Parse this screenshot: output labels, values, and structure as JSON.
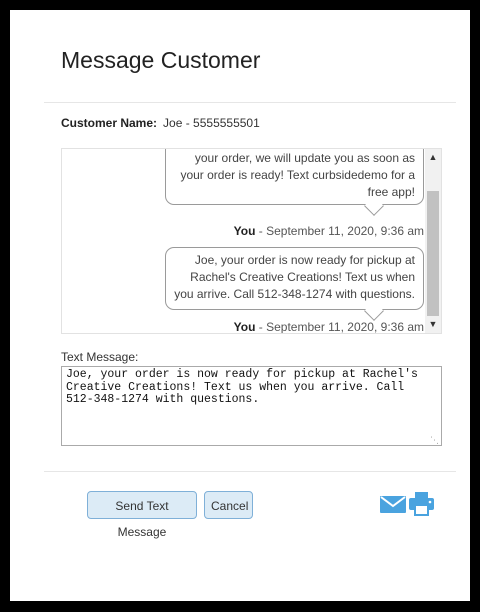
{
  "dialog": {
    "title": "Message Customer"
  },
  "customer": {
    "label": "Customer Name:",
    "value": "Joe - 5555555501"
  },
  "thread": {
    "messages": [
      {
        "text": "your order, we will update you as soon as your order is ready! Text curbsidedemo for a free app!",
        "sender": "You",
        "timestamp": " - September 11, 2020, 9:36 am"
      },
      {
        "text": "Joe, your order is now ready for pickup at Rachel's Creative Creations! Text us when you arrive. Call 512-348-1274 with questions.",
        "sender": "You",
        "timestamp": " - September 11, 2020, 9:36 am"
      }
    ]
  },
  "compose": {
    "label": "Text Message:",
    "value": "Joe, your order is now ready for pickup at Rachel's Creative Creations! Text us when you arrive. Call 512-348-1274 with questions."
  },
  "actions": {
    "send_label": "Send Text Message",
    "cancel_label": "Cancel"
  },
  "icons": {
    "email": "envelope-icon",
    "print": "printer-icon"
  },
  "colors": {
    "accent": "#4aa3df",
    "button_bg": "#dcebf6",
    "button_border": "#7fb0d8"
  }
}
